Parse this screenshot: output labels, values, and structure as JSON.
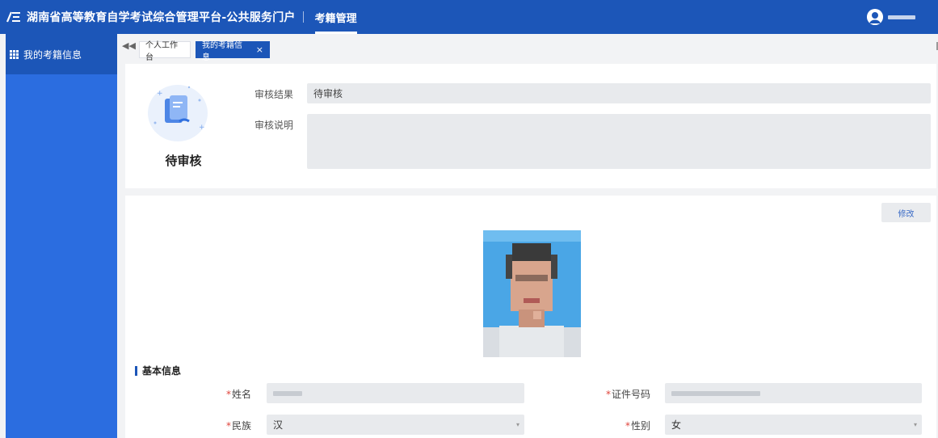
{
  "header": {
    "app_title": "湖南省高等教育自学考试综合管理平台-公共服务门户",
    "nav_item": "考籍管理",
    "brand_color": "#1c56b8"
  },
  "sidebar": {
    "items": [
      {
        "label": "我的考籍信息",
        "icon": "grid-icon"
      }
    ]
  },
  "tabs": {
    "collapse_icon": "double-left-arrow-icon",
    "items": [
      {
        "label": "个人工作台",
        "active": false
      },
      {
        "label": "我的考籍信息",
        "active": true,
        "close": "×"
      }
    ]
  },
  "review": {
    "status_text": "待审核",
    "result_label": "审核结果",
    "result_value": "待审核",
    "desc_label": "审核说明",
    "desc_value": ""
  },
  "info": {
    "modify_label": "修改",
    "section_title": "基本信息",
    "required_mark": "*",
    "fields": {
      "name_label": "姓名",
      "id_label": "证件号码",
      "ethnic_label": "民族",
      "ethnic_value": "汉",
      "gender_label": "性别",
      "gender_value": "女",
      "select_caret": "▾"
    }
  }
}
